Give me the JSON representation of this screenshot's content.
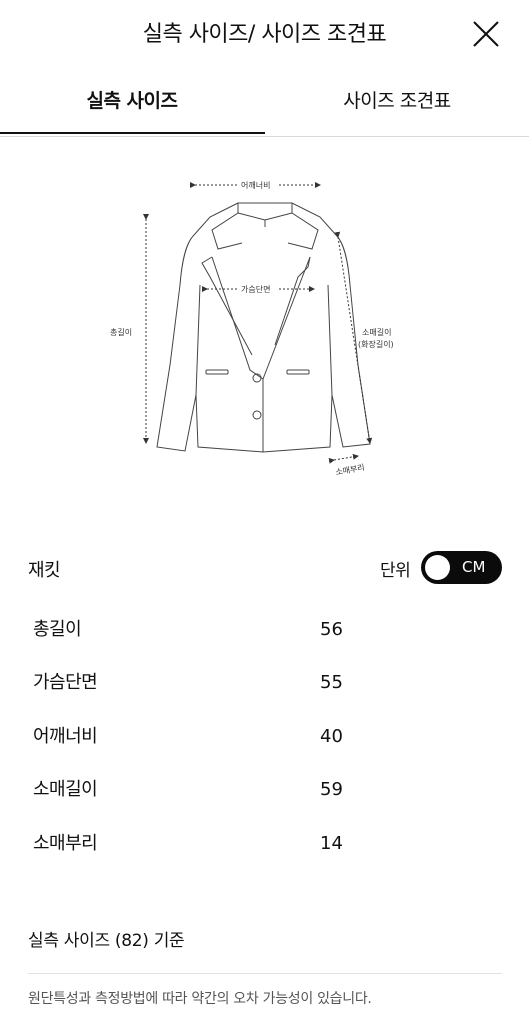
{
  "header": {
    "title": "실측 사이즈/ 사이즈 조견표"
  },
  "tabs": [
    {
      "label": "실측 사이즈",
      "active": true
    },
    {
      "label": "사이즈 조견표",
      "active": false
    }
  ],
  "diagram": {
    "labels": {
      "shoulder": "어깨너비",
      "chest": "가슴단면",
      "total_length": "총길이",
      "sleeve_length": "소매길이",
      "sleeve_length_alt": "(화장길이)",
      "sleeve_opening": "소매부리"
    }
  },
  "product": {
    "name": "재킷"
  },
  "unit": {
    "label": "단위",
    "value": "CM"
  },
  "sizes": [
    {
      "label": "총길이",
      "value": "56"
    },
    {
      "label": "가슴단면",
      "value": "55"
    },
    {
      "label": "어깨너비",
      "value": "40"
    },
    {
      "label": "소매길이",
      "value": "59"
    },
    {
      "label": "소매부리",
      "value": "14"
    }
  ],
  "basis_text": "실측 사이즈 (82) 기준",
  "note": "원단특성과 측정방법에 따라 약간의 오차 가능성이 있습니다.",
  "icons": {
    "close": "close-icon"
  }
}
